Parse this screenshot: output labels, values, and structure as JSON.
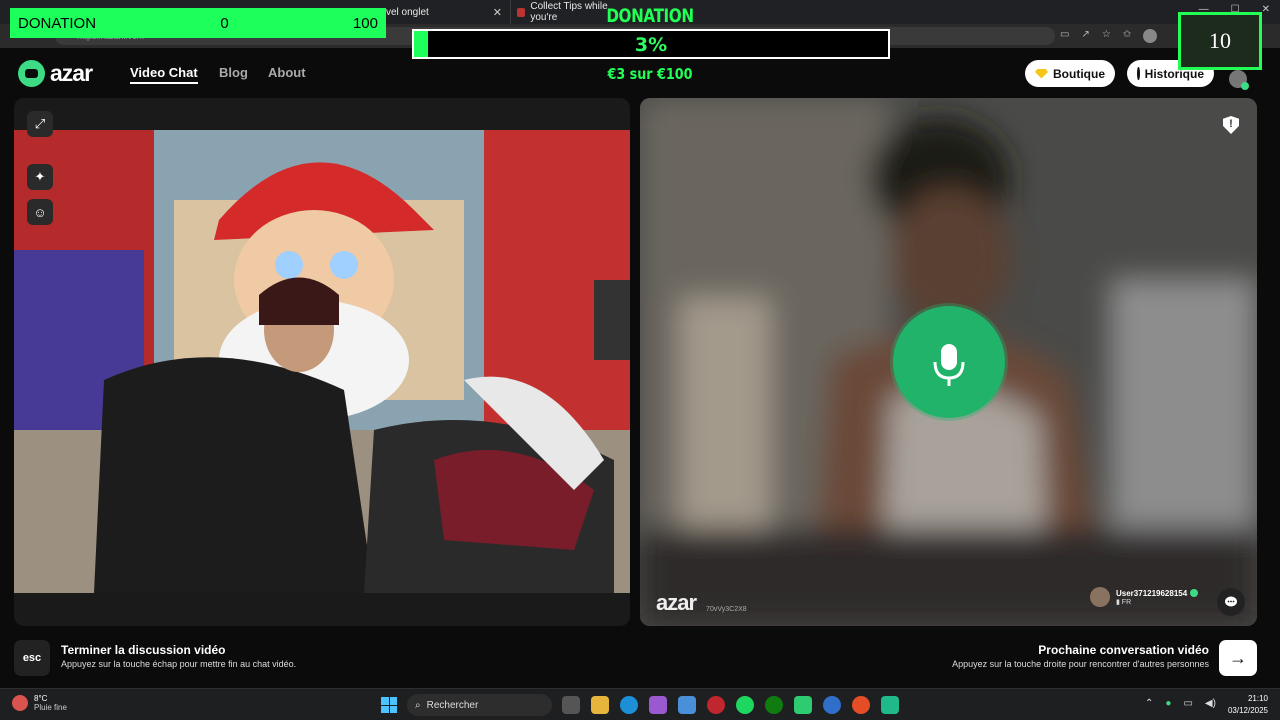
{
  "browser": {
    "tabs": [
      {
        "label": "vel onglet"
      },
      {
        "label": "Collect Tips while you're"
      }
    ],
    "url": "https://azar.live/fr"
  },
  "overlay": {
    "donation_label": "DONATION",
    "donation_current": "0",
    "donation_goal": "100",
    "title": "DONATION",
    "percent_text": "3%",
    "progress_fraction": 0.03,
    "amount_text": "€3 sur €100",
    "counter": "10",
    "accent": "#1dff5a"
  },
  "nav": {
    "brand": "azar",
    "links": [
      {
        "label": "Video Chat",
        "active": true
      },
      {
        "label": "Blog"
      },
      {
        "label": "About"
      }
    ],
    "boutique_label": "Boutique",
    "historique_label": "Historique"
  },
  "remote": {
    "watermark": "azar",
    "session_id": "70vVy3C2X8",
    "username": "User371219628154",
    "country": "FR"
  },
  "footer": {
    "esc_key": "esc",
    "end_title": "Terminer la discussion vidéo",
    "end_hint": "Appuyez sur la touche échap pour mettre fin au chat vidéo.",
    "next_title": "Prochaine conversation vidéo",
    "next_hint": "Appuyez sur la touche droite pour rencontrer d'autres personnes",
    "next_arrow": "→"
  },
  "taskbar": {
    "weather_temp": "8°C",
    "weather_desc": "Pluie fine",
    "search_placeholder": "Rechercher",
    "time": "21:10",
    "date": "03/12/2025"
  },
  "colors": {
    "brand_green": "#3ddc84",
    "mic_green": "#22b36a"
  }
}
